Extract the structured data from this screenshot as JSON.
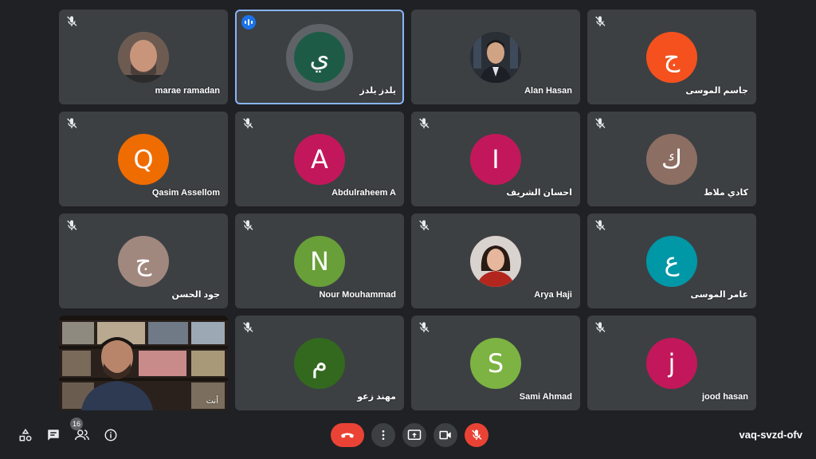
{
  "meeting": {
    "code": "vaq-svzd-ofv",
    "participant_count": "16"
  },
  "colors": {
    "tile_bg": "#3c4043",
    "page_bg": "#202124",
    "active_border": "#8ab4f8",
    "end_call": "#ea4335"
  },
  "participants": [
    {
      "name": "marae ramadan",
      "initial": "",
      "avatar_color": "#8a6f60",
      "photo": true
    },
    {
      "name": "يلدز يلدز",
      "initial": "ي",
      "avatar_color": "#1e5b46",
      "speaking": true
    },
    {
      "name": "Alan Hasan",
      "initial": "",
      "avatar_color": "#2a2f36",
      "photo": true
    },
    {
      "name": "جاسم الموسى",
      "initial": "ج",
      "avatar_color": "#f4511e"
    },
    {
      "name": "Qasim Assellom",
      "initial": "Q",
      "avatar_color": "#ef6c00"
    },
    {
      "name": "Abdulraheem A",
      "initial": "A",
      "avatar_color": "#c2185b"
    },
    {
      "name": "احسان الشريف",
      "initial": "I",
      "avatar_color": "#c2185b"
    },
    {
      "name": "كادي ملاط",
      "initial": "ك",
      "avatar_color": "#8d6e63"
    },
    {
      "name": "جود الحسن",
      "initial": "ج",
      "avatar_color": "#a1887f"
    },
    {
      "name": "Nour Mouhammad",
      "initial": "N",
      "avatar_color": "#689f38"
    },
    {
      "name": "Arya Haji",
      "initial": "",
      "avatar_color": "#b71c1c",
      "photo": true
    },
    {
      "name": "عامر الموسى",
      "initial": "ع",
      "avatar_color": "#0097a7"
    },
    {
      "name": "أنت",
      "initial": "",
      "self_video": true
    },
    {
      "name": "مهند زعو",
      "initial": "م",
      "avatar_color": "#33691e"
    },
    {
      "name": "Sami Ahmad",
      "initial": "S",
      "avatar_color": "#7cb342"
    },
    {
      "name": "jood hasan",
      "initial": "j",
      "avatar_color": "#c2185b"
    }
  ]
}
